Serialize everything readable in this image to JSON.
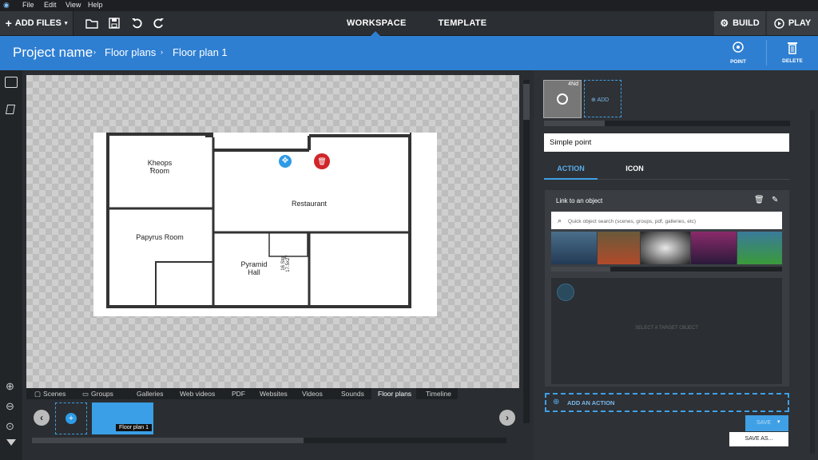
{
  "menu": {
    "items": [
      "File",
      "Edit",
      "View",
      "Help"
    ]
  },
  "toolbar": {
    "add_files": "ADD FILES",
    "tabs": [
      "WORKSPACE",
      "TEMPLATE"
    ],
    "build": "BUILD",
    "play": "PLAY"
  },
  "breadcrumb": {
    "project": "Project name",
    "section": "Floor plans",
    "current": "Floor plan 1"
  },
  "actions": {
    "point": "POINT",
    "delete": "DELETE"
  },
  "floorplan": {
    "rooms": [
      "Kheops Room",
      "Restaurant",
      "Papyrus Room",
      "Pyramid Hall"
    ],
    "stairs": "16 Stg 17.5x27"
  },
  "bottom_tabs": [
    "Scenes",
    "Groups",
    "Galleries",
    "Web videos",
    "PDF",
    "Websites",
    "Videos",
    "Sounds",
    "Floor plans",
    "Timeline"
  ],
  "bottom_active": "Floor plans",
  "thumb_label": "Floor plan 1",
  "right": {
    "thumb_tag": "4Nd",
    "add": "ADD",
    "name_value": "Simple point",
    "tabs": [
      "ACTION",
      "ICON"
    ],
    "link_title": "Link to an object",
    "search_placeholder": "Quick object search (scenes, groups, pdf, galleries, etc)",
    "select_target": "SELECT A TARGET OBJECT",
    "add_action": "ADD AN ACTION",
    "save": "SAVE",
    "save_as": "SAVE AS..."
  },
  "colors": {
    "accent": "#2e7fd2",
    "danger": "#d0262a",
    "panel": "#2e3135"
  }
}
